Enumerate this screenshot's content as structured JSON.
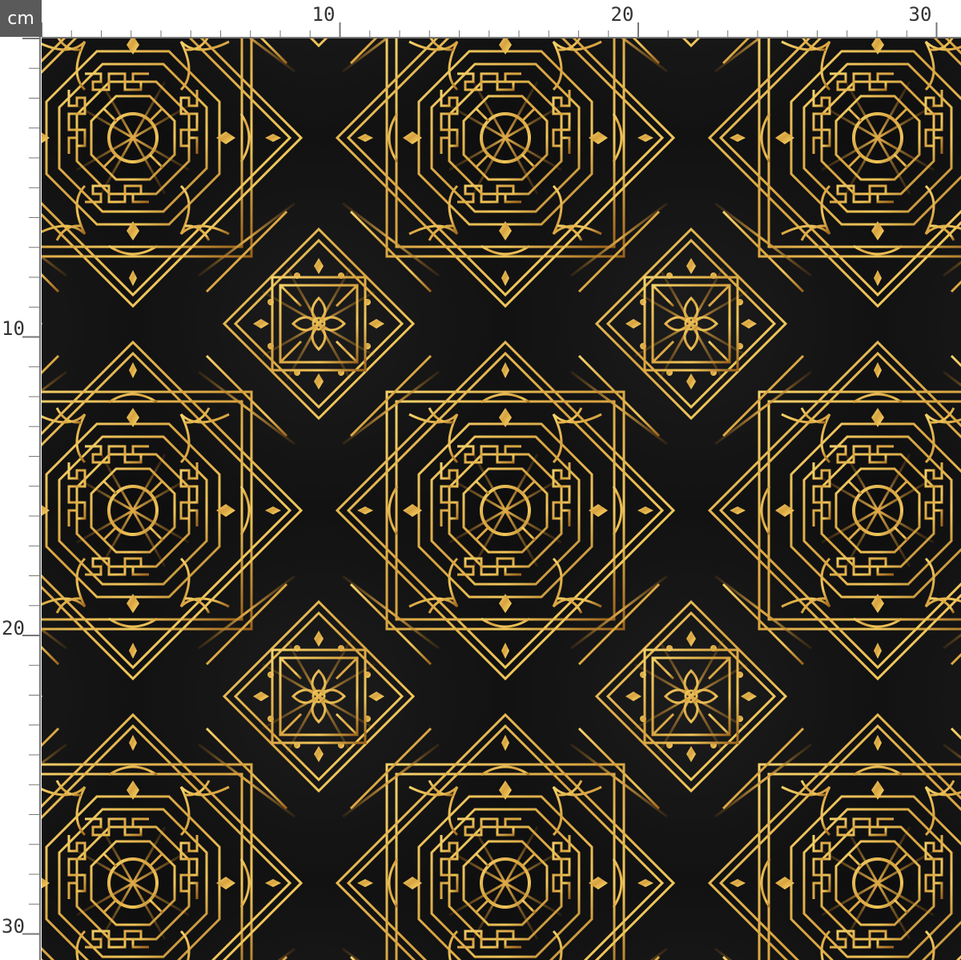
{
  "ruler": {
    "unit": "cm",
    "top_labels": [
      "10",
      "20",
      "30"
    ],
    "left_labels": [
      "10",
      "20",
      "30"
    ],
    "label_values": [
      10,
      20,
      30
    ]
  },
  "fabric": {
    "pattern": "gold-geometric-mandala",
    "colors": {
      "background": "#141414",
      "gold_light": "#f2cb5e",
      "gold_mid": "#d9a441",
      "gold_dark": "#8a5616"
    }
  }
}
